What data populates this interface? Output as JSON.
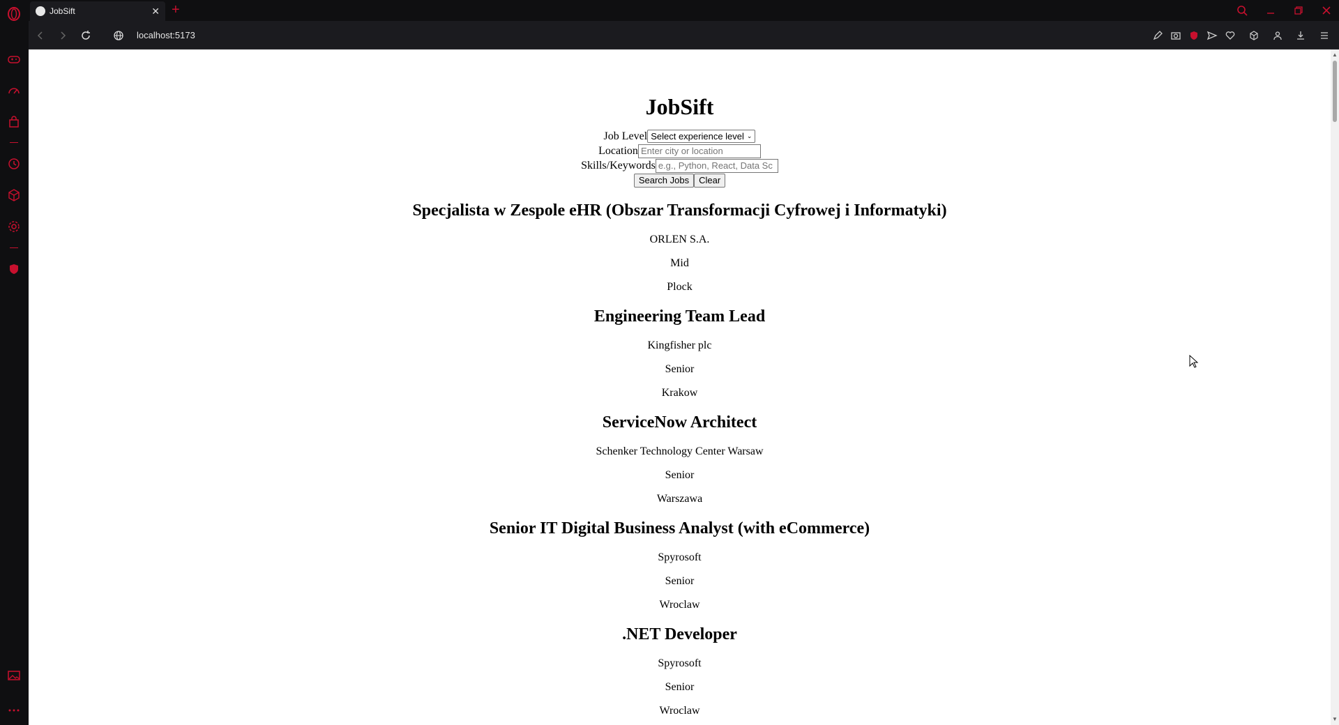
{
  "browser": {
    "tab_title": "JobSift",
    "tab_close": "✕",
    "new_tab": "+",
    "url": "localhost:5173"
  },
  "page": {
    "title": "JobSift",
    "form": {
      "job_level_label": "Job Level",
      "job_level_value": "Select experience level",
      "location_label": "Location",
      "location_placeholder": "Enter city or location",
      "skills_label": "Skills/Keywords",
      "skills_placeholder": "e.g., Python, React, Data Sc",
      "search_button": "Search Jobs",
      "clear_button": "Clear"
    },
    "jobs": [
      {
        "title": "Specjalista w Zespole eHR (Obszar Transformacji Cyfrowej i Informatyki)",
        "company": "ORLEN S.A.",
        "level": "Mid",
        "location": "Plock"
      },
      {
        "title": "Engineering Team Lead",
        "company": "Kingfisher plc",
        "level": "Senior",
        "location": "Krakow"
      },
      {
        "title": "ServiceNow Architect",
        "company": "Schenker Technology Center Warsaw",
        "level": "Senior",
        "location": "Warszawa"
      },
      {
        "title": "Senior IT Digital Business Analyst (with eCommerce)",
        "company": "Spyrosoft",
        "level": "Senior",
        "location": "Wroclaw"
      },
      {
        "title": ".NET Developer",
        "company": "Spyrosoft",
        "level": "Senior",
        "location": "Wroclaw"
      }
    ]
  },
  "colors": {
    "accent": "#c8102e",
    "chrome_bg": "#0f0f11",
    "toolbar_bg": "#1b1b1f"
  }
}
